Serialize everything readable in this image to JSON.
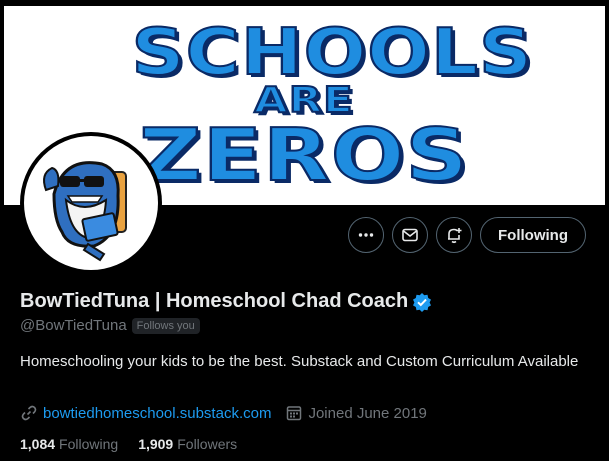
{
  "banner": {
    "line1": "SCHOOLS",
    "line2": "ARE",
    "line3": "ZEROS"
  },
  "actions": {
    "more_icon": "more-dots-icon",
    "message_icon": "envelope-icon",
    "notify_icon": "bell-plus-icon",
    "follow_label": "Following"
  },
  "profile": {
    "display_name": "BowTiedTuna | Homeschool Chad Coach",
    "verified_icon": "verified-badge-icon",
    "handle": "@BowTiedTuna",
    "follows_you": "Follows you",
    "bio": "Homeschooling your kids to be the best. Substack and Custom Curriculum Available",
    "website": "bowtiedhomeschool.substack.com",
    "joined": "Joined June 2019"
  },
  "stats": {
    "following_count": "1,084",
    "following_label": "Following",
    "followers_count": "1,909",
    "followers_label": "Followers"
  },
  "colors": {
    "accent": "#1d9bf0",
    "muted": "#71767b",
    "text": "#e7e9ea",
    "background": "#000000"
  }
}
